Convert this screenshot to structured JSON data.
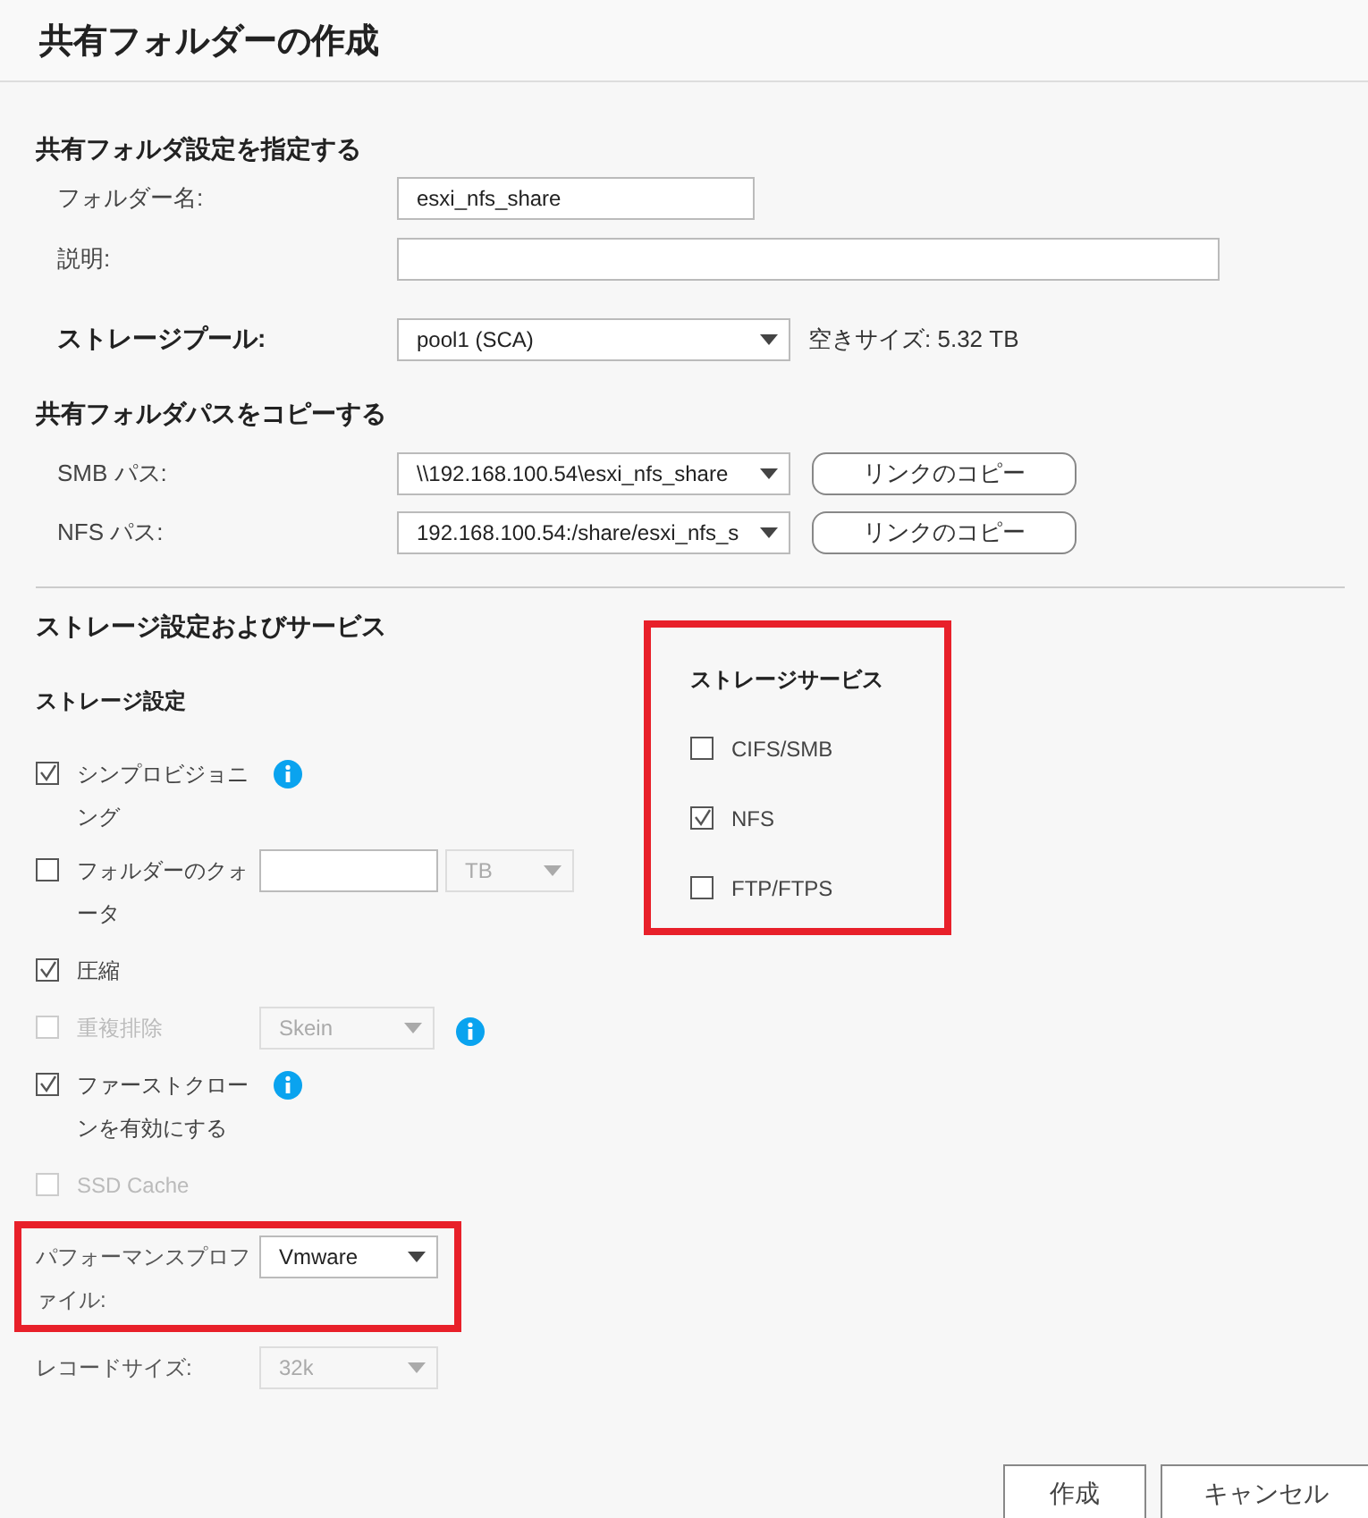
{
  "window": {
    "title": "共有フォルダーの作成"
  },
  "share_settings": {
    "heading": "共有フォルダ設定を指定する",
    "fields": [
      {
        "label": "フォルダー名:",
        "value": "esxi_nfs_share"
      },
      {
        "label": "説明:"
      }
    ]
  },
  "storage_pool": {
    "label": "ストレージプール:",
    "value": "pool1 (SCA)",
    "free_space": "空きサイズ: 5.32 TB"
  },
  "copy_paths": {
    "heading": "共有フォルダパスをコピーする",
    "paths": [
      {
        "label": "SMB パス:",
        "value": "\\\\192.168.100.54\\esxi_nfs_share",
        "button": "リンクのコピー"
      },
      {
        "label": "NFS パス:",
        "value": "192.168.100.54:/share/esxi_nfs_s",
        "button": "リンクのコピー"
      }
    ]
  },
  "storage_section": {
    "heading": "ストレージ設定およびサービス",
    "settings": {
      "heading": "ストレージ設定",
      "items": [
        {
          "kind": "checkbox",
          "label": "シンプロビジョニング",
          "checked": true,
          "disabled": false,
          "info": true
        },
        {
          "kind": "checkbox",
          "label": "フォルダーのクォータ",
          "checked": false,
          "disabled": false,
          "quota": {
            "unit": "TB"
          }
        },
        {
          "kind": "checkbox",
          "label": "圧縮",
          "checked": true,
          "disabled": false
        },
        {
          "kind": "checkbox",
          "label": "重複排除",
          "checked": false,
          "disabled": true,
          "select": "Skein",
          "info": true
        },
        {
          "kind": "checkbox",
          "label": "ファーストクローンを有効にする",
          "checked": true,
          "disabled": false,
          "info": true
        },
        {
          "kind": "checkbox",
          "label": "SSD Cache",
          "checked": false,
          "disabled": true
        },
        {
          "kind": "select",
          "label": "パフォーマンスプロファイル:",
          "select": "Vmware",
          "disabled": false,
          "highlighted": true
        },
        {
          "kind": "select",
          "label": "レコードサイズ:",
          "select": "32k",
          "disabled": true,
          "highlighted": false
        }
      ]
    },
    "services": {
      "heading": "ストレージサービス",
      "highlighted": true,
      "items": [
        {
          "label": "CIFS/SMB",
          "checked": false
        },
        {
          "label": "NFS",
          "checked": true
        },
        {
          "label": "FTP/FTPS",
          "checked": false
        }
      ]
    }
  },
  "buttons": [
    {
      "label": "作成"
    },
    {
      "label": "キャンセル"
    }
  ]
}
